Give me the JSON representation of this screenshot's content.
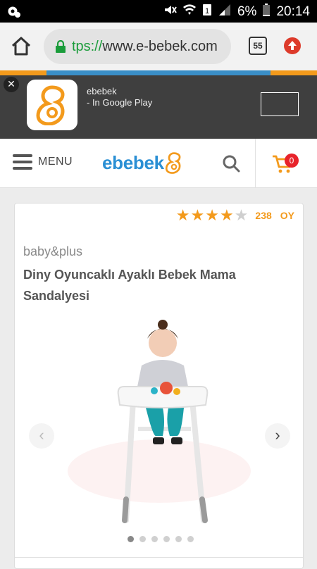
{
  "status_bar": {
    "battery": "6%",
    "time": "20:14"
  },
  "browser": {
    "url_scheme": "tps://",
    "url_host": "www.e-bebek.com",
    "tab_count": "55"
  },
  "app_banner": {
    "app_name": "ebebek",
    "store_text": "- In Google Play"
  },
  "site_header": {
    "menu_label": "MENU",
    "logo_text": "ebebek",
    "cart_count": "0"
  },
  "product": {
    "rating": 4,
    "rating_max": 5,
    "review_count": "238",
    "review_suffix": "OY",
    "brand": "baby&plus",
    "title": "Diny Oyuncaklı Ayaklı Bebek Mama Sandalyesi",
    "gallery_dot_count": 6,
    "gallery_active_index": 0
  },
  "colors": {
    "accent_orange": "#f39a1c",
    "brand_blue": "#2a8fd4",
    "badge_red": "#e8232b"
  }
}
